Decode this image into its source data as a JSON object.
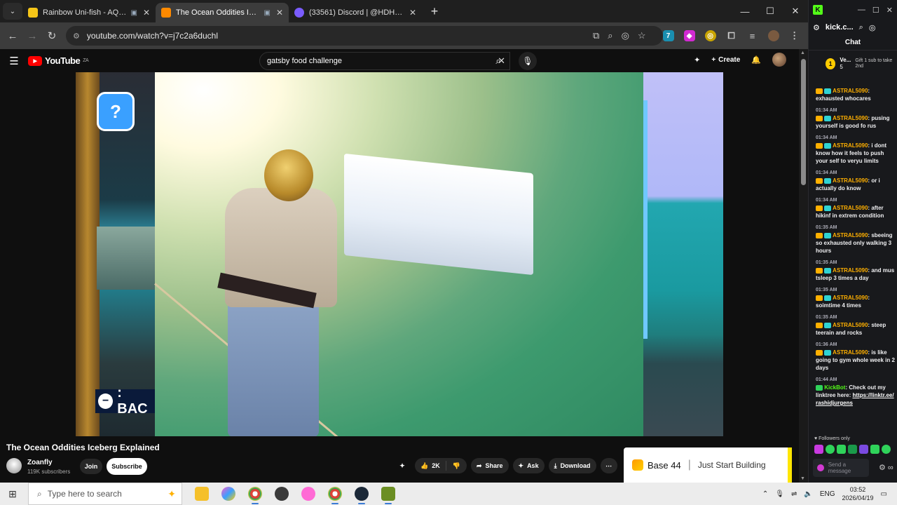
{
  "browser": {
    "tabs": [
      {
        "label": "Rainbow Uni-fish - AQ3D",
        "favicon": "yellow-square",
        "active": false,
        "favicon_color": "#f5c518"
      },
      {
        "label": "The Ocean Oddities Iceberg",
        "favicon": "youtube",
        "active": true,
        "favicon_color": "#ff8a00"
      },
      {
        "label": "(33561) Discord | @HDHDHDH",
        "favicon": "discord",
        "active": false,
        "favicon_color": "#7a5cff"
      }
    ],
    "url": "youtube.com/watch?v=j7c2a6duchl"
  },
  "youtube": {
    "logo": "YouTube",
    "logo_region": "ZA",
    "search_query": "gatsby food challenge",
    "create_label": "Create"
  },
  "video": {
    "overlay_text": ": BAC",
    "title": "The Ocean Oddities Iceberg Explained",
    "channel": "Zoanfly",
    "subscribers": "119K subscribers",
    "join_label": "Join",
    "subscribe_label": "Subscribe",
    "likes": "2K",
    "share_label": "Share",
    "ask_label": "Ask",
    "download_label": "Download"
  },
  "ad": {
    "brand": "Base 44",
    "tagline": "Just Start Building"
  },
  "kick": {
    "url": "kick.c...",
    "chat_title": "Chat",
    "pinned_user": "Ve...",
    "pinned_count": "5",
    "pinned_rank": "1",
    "gift_text": "Gift 1 sub to take 2nd",
    "messages": [
      {
        "time": "",
        "user": "ASTRAL5090",
        "text": "exhausted whocares"
      },
      {
        "time": "01:34 AM",
        "user": "ASTRAL5090",
        "text": "pusing yourself is good fo rus"
      },
      {
        "time": "01:34 AM",
        "user": "ASTRAL5090",
        "text": "i dont know how it feels to push your self to veryu limits"
      },
      {
        "time": "01:34 AM",
        "user": "ASTRAL5090",
        "text": "or i actually do know"
      },
      {
        "time": "01:34 AM",
        "user": "ASTRAL5090",
        "text": "after hikinf in extrem condition"
      },
      {
        "time": "01:35 AM",
        "user": "ASTRAL5090",
        "text": "sbeeing so exhausted only walking 3 hours"
      },
      {
        "time": "01:35 AM",
        "user": "ASTRAL5090",
        "text": "and mus tsleep 3 times a day"
      },
      {
        "time": "01:35 AM",
        "user": "ASTRAL5090",
        "text": "soimtime 4 times"
      },
      {
        "time": "01:35 AM",
        "user": "ASTRAL5090",
        "text": "steep teerain and rocks"
      },
      {
        "time": "01:36 AM",
        "user": "ASTRAL5090",
        "text": "is like going to gym whole week in 2 days"
      }
    ],
    "bot_message": {
      "time": "01:44 AM",
      "user": "KickBot",
      "text": "Check out my linktree here:",
      "link": "https://linktr.ee/rashidjurgens"
    },
    "followers_only": "Followers only",
    "send_placeholder": "Send a message"
  },
  "taskbar": {
    "search_placeholder": "Type here to search",
    "lang": "ENG",
    "time": "03:52",
    "date": "2026/04/19"
  }
}
